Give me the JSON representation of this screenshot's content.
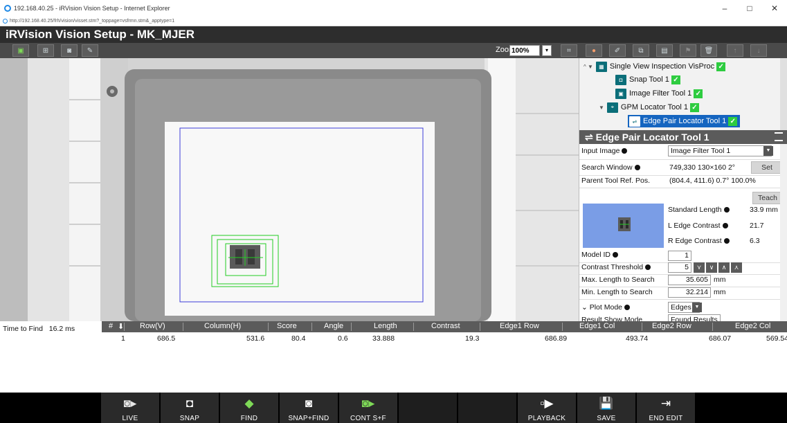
{
  "browser": {
    "window_title": "192.168.40.25 - iRVision Vision Setup - Internet Explorer",
    "url": "http://192.168.40.25/frh/vision/visset.stm?_toppage=vsfrmn.stm&_apptype=1",
    "controls": [
      "–",
      "□",
      "✕"
    ]
  },
  "app": {
    "title": "iRVision Vision Setup - MK_MJER"
  },
  "toolbar": {
    "zoom_label": "Zoom",
    "zoom_value": "100%",
    "zoom_arrow": "▾"
  },
  "tree": {
    "items": [
      {
        "label": "Single View Inspection VisProc",
        "icon": "vision-process-icon",
        "checked": true
      },
      {
        "label": "Snap Tool 1",
        "icon": "snap-tool-icon",
        "checked": true
      },
      {
        "label": "Image Filter Tool 1",
        "icon": "image-filter-icon",
        "checked": true
      },
      {
        "label": "GPM Locator Tool 1",
        "icon": "gpm-locator-icon",
        "checked": true
      },
      {
        "label": "Edge Pair Locator Tool 1",
        "icon": "edge-pair-icon",
        "checked": true,
        "selected": true
      }
    ]
  },
  "properties": {
    "header": "Edge Pair Locator Tool 1",
    "input_image_label": "Input Image",
    "input_image_value": "Image Filter Tool 1",
    "search_window_label": "Search Window",
    "search_window_value": "749,330 130×160 2°",
    "set_button": "Set",
    "parent_ref_label": "Parent Tool Ref. Pos.",
    "parent_ref_value": "(804.4, 411.6) 0.7° 100.0%",
    "teach_button": "Teach",
    "standard_length_label": "Standard Length",
    "standard_length_value": "33.9 mm",
    "l_edge_contrast_label": "L Edge Contrast",
    "l_edge_contrast_value": "21.7",
    "r_edge_contrast_label": "R Edge Contrast",
    "r_edge_contrast_value": "6.3",
    "model_id_label": "Model ID",
    "model_id_value": "1",
    "contrast_threshold_label": "Contrast Threshold",
    "contrast_threshold_value": "5",
    "max_length_label": "Max. Length to Search",
    "max_length_value": "35.605",
    "min_length_label": "Min. Length to Search",
    "min_length_value": "32.214",
    "unit_mm": "mm",
    "plot_mode_label": "Plot Mode",
    "plot_mode_value": "Edges",
    "result_show_mode_label": "Result Show Mode",
    "result_show_mode_value": "Found Results"
  },
  "results": {
    "time_to_find_label": "Time to Find",
    "time_to_find_value": "16.2 ms",
    "columns": [
      "#",
      "Row(V)",
      "Column(H)",
      "Score",
      "Angle",
      "Length",
      "Contrast",
      "Edge1 Row",
      "Edge1 Col",
      "Edge2 Row",
      "Edge2 Col"
    ],
    "rows": [
      [
        "1",
        "686.5",
        "531.6",
        "80.4",
        "0.6",
        "33.888",
        "19.3",
        "686.89",
        "493.74",
        "686.07",
        "569.54"
      ]
    ]
  },
  "bottom_buttons": [
    {
      "label": "LIVE",
      "icon": "live-camera-icon"
    },
    {
      "label": "SNAP",
      "icon": "snap-camera-icon"
    },
    {
      "label": "FIND",
      "icon": "find-icon"
    },
    {
      "label": "SNAP+FIND",
      "icon": "snap-find-icon"
    },
    {
      "label": "CONT S+F",
      "icon": "continuous-snap-find-icon"
    },
    {
      "label": "",
      "icon": ""
    },
    {
      "label": "",
      "icon": ""
    },
    {
      "label": "PLAYBACK",
      "icon": "playback-icon"
    },
    {
      "label": "SAVE",
      "icon": "save-icon"
    },
    {
      "label": "END EDIT",
      "icon": "exit-icon"
    }
  ],
  "colors": {
    "header_bg": "#2d2d2d",
    "toolbar_bg": "#4a4a4a",
    "panel_header_bg": "#5b5b5b",
    "selected_tree_bg": "#1565c0",
    "check_green": "#2ecc40",
    "search_window_blue": "#3b3bd9",
    "found_green": "#22cc22",
    "bottom_bar_bg": "#000000"
  }
}
